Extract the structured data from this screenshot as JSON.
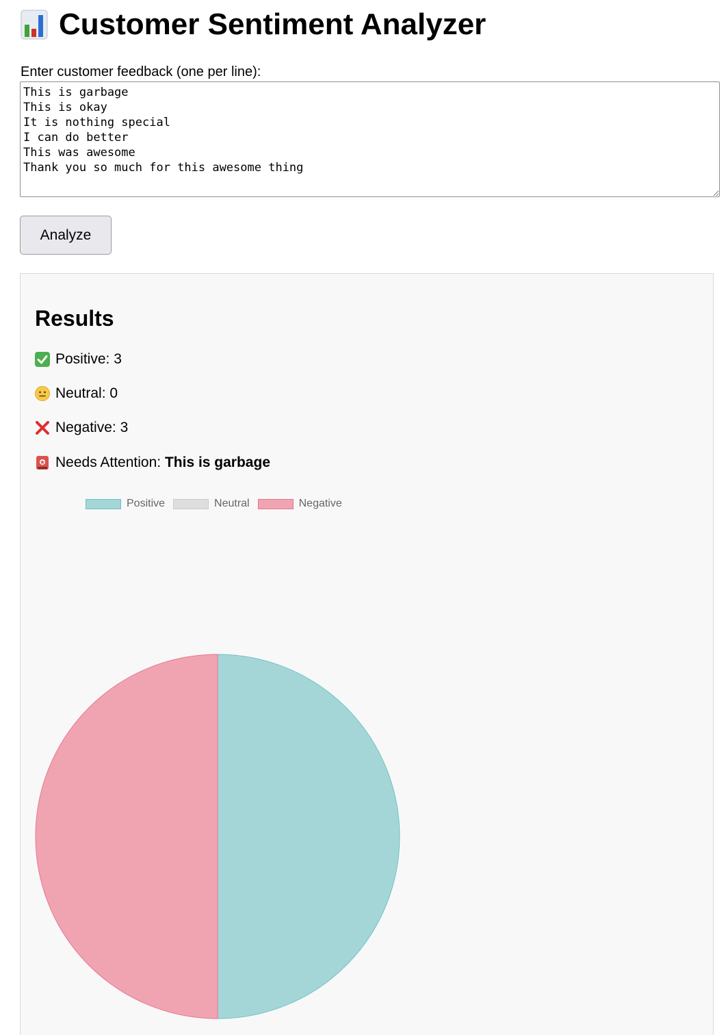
{
  "header": {
    "title": "Customer Sentiment Analyzer",
    "icon": "bar-chart-icon"
  },
  "feedback": {
    "label": "Enter customer feedback (one per line):",
    "value": "This is garbage\nThis is okay\nIt is nothing special\nI can do better\nThis was awesome\nThank you so much for this awesome thing"
  },
  "actions": {
    "analyze_label": "Analyze"
  },
  "results": {
    "heading": "Results",
    "positive": {
      "icon": "check-mark-icon",
      "label": "Positive: ",
      "count": "3"
    },
    "neutral": {
      "icon": "neutral-face-icon",
      "label": "Neutral: ",
      "count": "0"
    },
    "negative": {
      "icon": "cross-mark-icon",
      "label": "Negative: ",
      "count": "3"
    },
    "attention": {
      "icon": "siren-icon",
      "label": "Needs Attention: ",
      "value": "This is garbage"
    }
  },
  "colors": {
    "positive_fill": "#a5d6d7",
    "positive_border": "#6fc2c4",
    "neutral_fill": "#dedede",
    "neutral_border": "#cccccc",
    "negative_fill": "#f0a4b2",
    "negative_border": "#e8758c"
  },
  "chart_data": {
    "type": "pie",
    "categories": [
      "Positive",
      "Neutral",
      "Negative"
    ],
    "values": [
      3,
      0,
      3
    ],
    "legend": "top",
    "title": ""
  }
}
